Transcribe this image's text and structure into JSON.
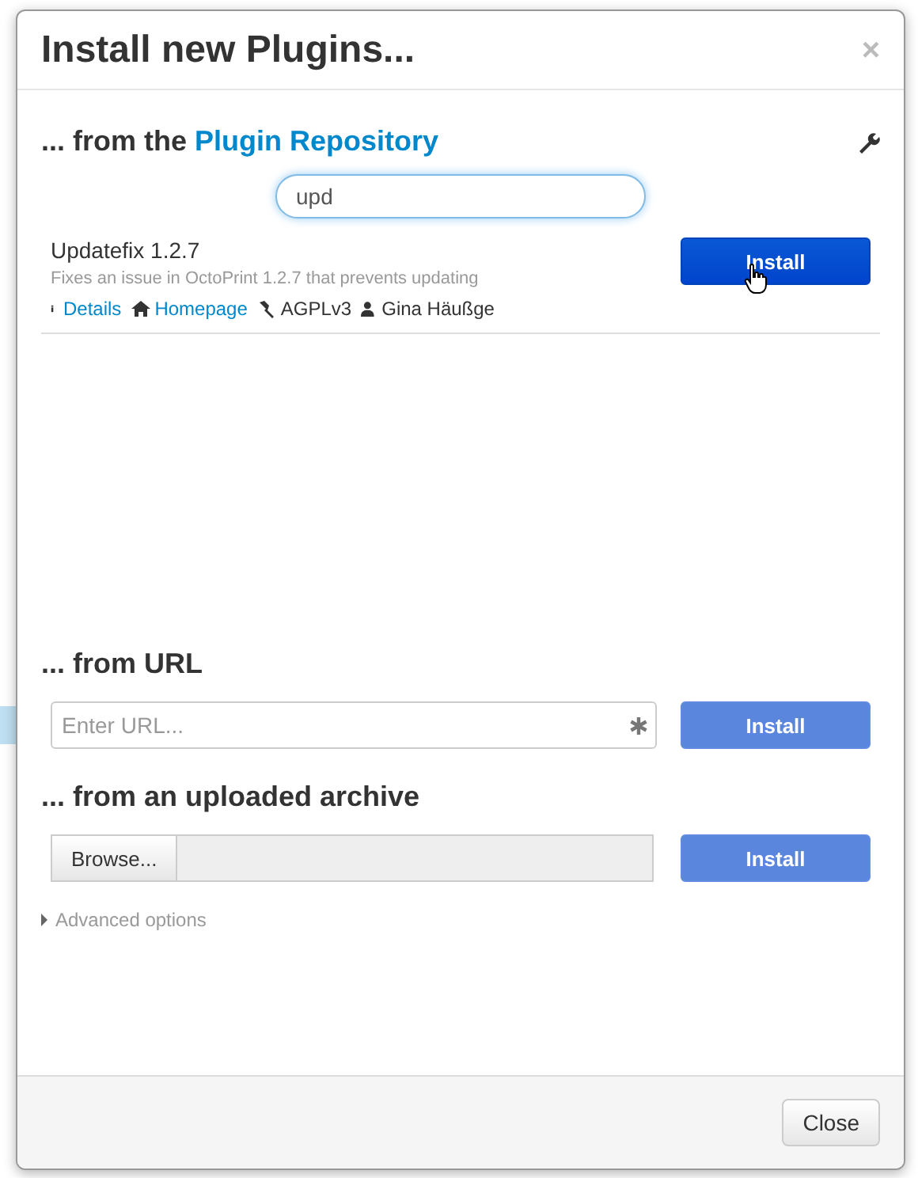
{
  "dialog": {
    "title": "Install new Plugins...",
    "close_glyph": "×"
  },
  "repository": {
    "heading_prefix": "... from the ",
    "heading_link": "Plugin Repository",
    "search": {
      "value": "upd"
    },
    "plugins": [
      {
        "name": "Updatefix 1.2.7",
        "description": "Fixes an issue in OctoPrint 1.2.7 that prevents updating",
        "details": "Details",
        "homepage": "Homepage",
        "license": "AGPLv3",
        "author": "Gina Häußge",
        "button": {
          "label": "Install",
          "disabled": false
        }
      }
    ]
  },
  "url_section": {
    "heading": "... from URL",
    "placeholder": "Enter URL...",
    "button": {
      "label": "Install",
      "disabled": true
    }
  },
  "archive_section": {
    "heading": "... from an uploaded archive",
    "browse": "Browse...",
    "button": {
      "label": "Install",
      "disabled": true
    }
  },
  "advanced": {
    "label": "Advanced options",
    "expanded": false
  },
  "footer": {
    "close": "Close"
  }
}
